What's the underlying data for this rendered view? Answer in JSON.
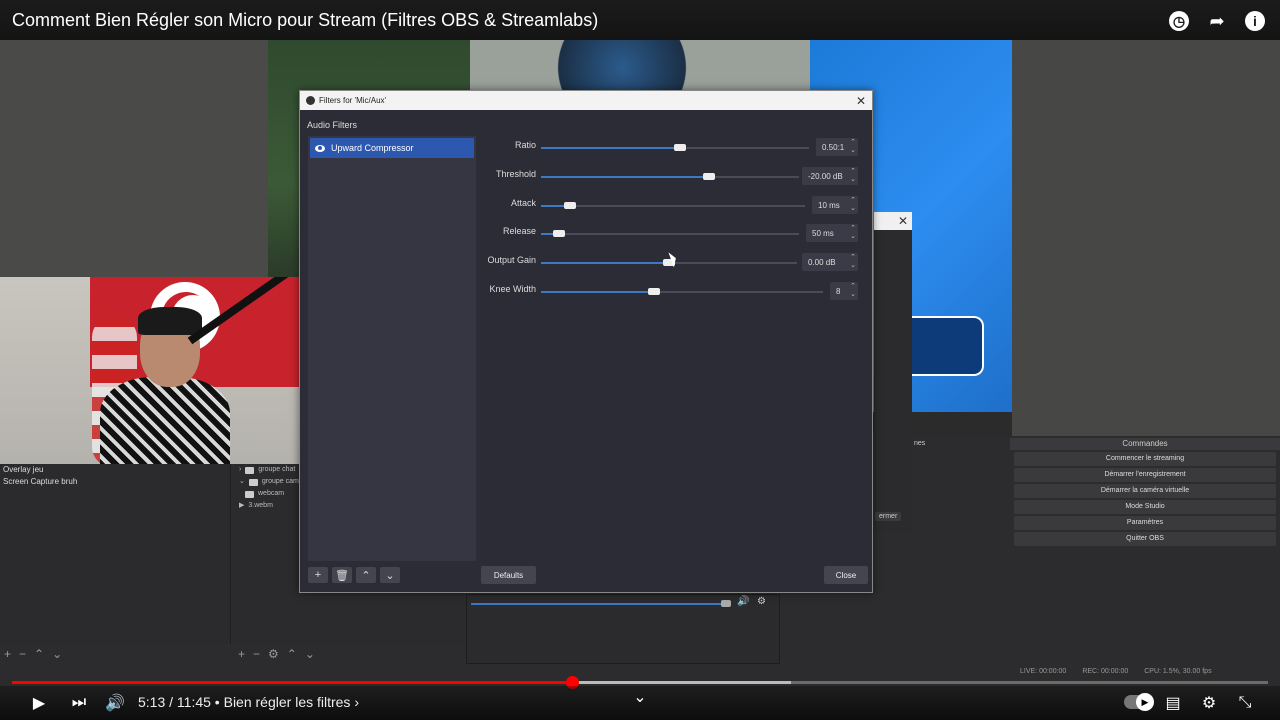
{
  "video": {
    "title": "Comment Bien Régler son Micro pour Stream (Filtres OBS & Streamlabs)",
    "icons": [
      "clock-icon",
      "share-icon",
      "info-icon"
    ]
  },
  "obs": {
    "sources": [
      "Overlay jeu",
      "Screen Capture bruh"
    ],
    "scene_tree": [
      {
        "label": "groupe chat",
        "icon": "folder"
      },
      {
        "label": "groupe cam",
        "icon": "folder"
      },
      {
        "label": "webcam",
        "icon": "folder"
      },
      {
        "label": "3.webm",
        "icon": "play"
      }
    ],
    "commands_title": "Commandes",
    "commands": [
      "Commencer le streaming",
      "Démarrer l'enregistrement",
      "Démarrer la caméra virtuelle",
      "Mode Studio",
      "Paramètres",
      "Quitter OBS"
    ],
    "panel_fragment_1": "nes",
    "panel_fragment_2": "ermer",
    "status": {
      "live": "LIVE: 00:00:00",
      "rec": "REC: 00:00:00",
      "cpu": "CPU: 1.5%, 30.00 fps"
    }
  },
  "dialog": {
    "title": "Filters for 'Mic/Aux'",
    "section": "Audio Filters",
    "filters": [
      {
        "name": "Upward Compressor",
        "selected": true
      }
    ],
    "properties": [
      {
        "label": "Ratio",
        "value": "0.50:1",
        "fraction": 0.52
      },
      {
        "label": "Threshold",
        "value": "-20.00 dB",
        "fraction": 0.65
      },
      {
        "label": "Attack",
        "value": "10 ms",
        "fraction": 0.11
      },
      {
        "label": "Release",
        "value": "50 ms",
        "fraction": 0.07
      },
      {
        "label": "Output Gain",
        "value": "0.00 dB",
        "fraction": 0.5
      },
      {
        "label": "Knee Width",
        "value": "8",
        "fraction": 0.4
      }
    ],
    "defaults_label": "Defaults",
    "close_label": "Close"
  },
  "player": {
    "current_time": "5:13",
    "duration": "11:45",
    "chapter": "Bien régler les filtres",
    "played_fraction": 0.446,
    "loaded_fraction": 0.62,
    "accent": "#ff0000"
  }
}
